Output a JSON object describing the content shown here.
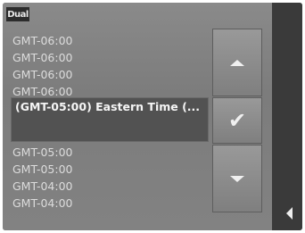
{
  "logo": {
    "text": "Dual"
  },
  "timezones_above": [
    "GMT-06:00",
    "GMT-06:00",
    "GMT-06:00",
    "GMT-06:00"
  ],
  "selected_timezone": "(GMT-05:00) Eastern Time (...",
  "timezones_below": [
    "GMT-05:00",
    "GMT-05:00",
    "GMT-04:00",
    "GMT-04:00"
  ],
  "icons": {
    "up": "triangle-up-icon",
    "confirm": "checkmark-icon",
    "down": "triangle-down-icon",
    "back": "triangle-left-icon"
  },
  "colors": {
    "list_text": "#dcdcdc",
    "selected_bg": "#525252",
    "side_bar": "#3a3a3a"
  }
}
